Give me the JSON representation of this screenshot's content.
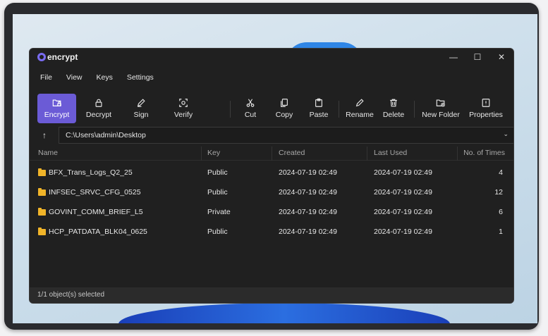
{
  "app": {
    "name": "encrypt",
    "window_controls": {
      "minimize": "—",
      "maximize": "☐",
      "close": "✕"
    }
  },
  "menu": [
    "File",
    "View",
    "Keys",
    "Settings"
  ],
  "toolbar": {
    "encrypt": "Encrypt",
    "decrypt": "Decrypt",
    "sign": "Sign",
    "verify": "Verify",
    "cut": "Cut",
    "copy": "Copy",
    "paste": "Paste",
    "rename": "Rename",
    "delete": "Delete",
    "new_folder": "New Folder",
    "properties": "Properties"
  },
  "address": {
    "up_icon": "↑",
    "path": "C:\\Users\\admin\\Desktop",
    "chevron": "⌄"
  },
  "table": {
    "headers": [
      "Name",
      "Key",
      "Created",
      "Last Used",
      "No. of Times"
    ],
    "rows": [
      {
        "name": "BFX_Trans_Logs_Q2_25",
        "key": "Public",
        "created": "2024-07-19 02:49",
        "last_used": "2024-07-19 02:49",
        "times": "4"
      },
      {
        "name": "INFSEC_SRVC_CFG_0525",
        "key": "Public",
        "created": "2024-07-19 02:49",
        "last_used": "2024-07-19 02:49",
        "times": "12"
      },
      {
        "name": "GOVINT_COMM_BRIEF_L5",
        "key": "Private",
        "created": "2024-07-19 02:49",
        "last_used": "2024-07-19 02:49",
        "times": "6"
      },
      {
        "name": "HCP_PATDATA_BLK04_0625",
        "key": "Public",
        "created": "2024-07-19 02:49",
        "last_used": "2024-07-19 02:49",
        "times": "1"
      }
    ]
  },
  "status": "1/1 object(s) selected",
  "colors": {
    "accent": "#6b5bd6",
    "folder": "#f0b429",
    "window_bg": "#202020"
  }
}
